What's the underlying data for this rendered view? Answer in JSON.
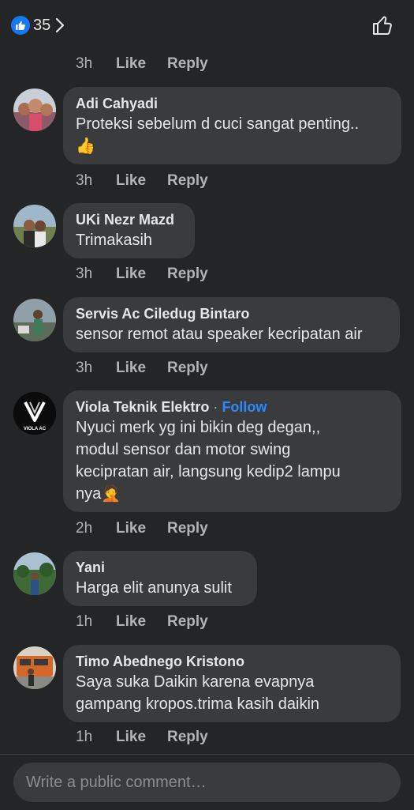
{
  "header": {
    "reaction_count": "35"
  },
  "top_actions": {
    "time": "3h",
    "like": "Like",
    "reply": "Reply"
  },
  "comments": [
    {
      "name": "Adi Cahyadi",
      "text": "Proteksi sebelum d cuci sangat penting..",
      "emoji": "👍",
      "time": "3h",
      "like": "Like",
      "reply": "Reply"
    },
    {
      "name": "UKi Nezr Mazd",
      "text": "Trimakasih",
      "time": "3h",
      "like": "Like",
      "reply": "Reply"
    },
    {
      "name": "Servis Ac Ciledug Bintaro",
      "text": "sensor remot atau speaker kecripatan air",
      "time": "3h",
      "like": "Like",
      "reply": "Reply"
    },
    {
      "name": "Viola Teknik Elektro",
      "dot": "·",
      "follow": "Follow",
      "avatar_text": "VIOLA AC",
      "text": "Nyuci merk yg ini bikin deg degan,,\nmodul sensor dan  motor swing\nkecipratan air, langsung kedip2 lampu\nnya",
      "emoji": "🤦",
      "time": "2h",
      "like": "Like",
      "reply": "Reply"
    },
    {
      "name": "Yani",
      "text": "Harga elit anunya sulit",
      "time": "1h",
      "like": "Like",
      "reply": "Reply"
    },
    {
      "name": "Timo Abednego Kristono",
      "text": "Saya suka Daikin karena evapnya\ngampang kropos.trima kasih daikin",
      "time": "1h",
      "like": "Like",
      "reply": "Reply"
    }
  ],
  "composer": {
    "placeholder": "Write a public comment…"
  },
  "colors": {
    "background": "#242526",
    "bubble": "#3a3b3c",
    "follow": "#2d88ff",
    "like_badge": "#1877f2"
  }
}
